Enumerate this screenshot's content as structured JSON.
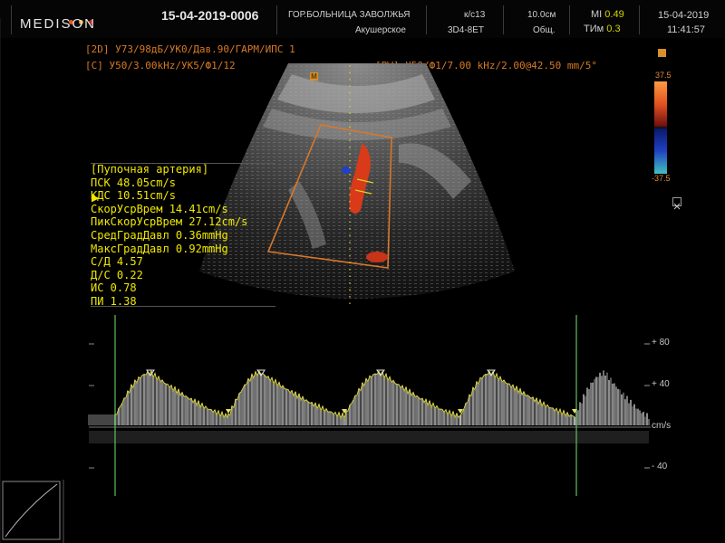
{
  "header": {
    "brand": "MEDISON",
    "brand_dot_colors": [
      "#e05a20",
      "#e0a020",
      "#d02020"
    ],
    "patient_id": "15-04-2019-0006",
    "hospital": "ГОР.БОЛЬНИЦА ЗАВОЛЖЬЯ",
    "department": "Акушерское",
    "frame": "к/с13",
    "probe": "3D4-8ET",
    "depth": "10.0см",
    "preset": "Общ.",
    "mi_label": "MI",
    "mi_value": "0.49",
    "tim_label": "TИм",
    "tim_value": "0.3",
    "date": "15-04-2019",
    "time": "11:41:57"
  },
  "params": {
    "mode_2d": "[2D] У73/98дБ/УК0/Дав.90/ГАРМ/ИПС 1",
    "mode_c": "[C] У50/3.00kHz/УК5/Ф1/12",
    "mode_pw": "[PW] У50/Ф1/7.00 kHz/2.00@42.50 mm/5°"
  },
  "measurements": {
    "title": "[Пупочная артерия]",
    "rows": [
      "ПСК 48.05cm/s",
      "КДС 10.51cm/s",
      "СкорУсрВрем 14.41cm/s",
      "ПикСкорУсрВрем 27.12cm/s",
      "СредГрадДавл 0.36mmHg",
      "МаксГрадДавл 0.92mmHg",
      "С/Д 4.57",
      "Д/С 0.22",
      "ИС  0.78",
      "ПИ  1.38"
    ]
  },
  "doppler_scale": {
    "label_80": "+ 80",
    "label_40": "+ 40",
    "unit": "cm/s",
    "label_neg40": "- 40"
  },
  "colorbar": {
    "top": "37.5",
    "bottom": "-37.5"
  },
  "icons": {
    "marker": "m-marker-icon",
    "freeze": "freeze-icon",
    "close": "close-icon"
  },
  "colors": {
    "accent": "#d87a24",
    "measure": "#f0e800",
    "cursor": "#e0d020",
    "baseline_marker": "#5cc060"
  }
}
